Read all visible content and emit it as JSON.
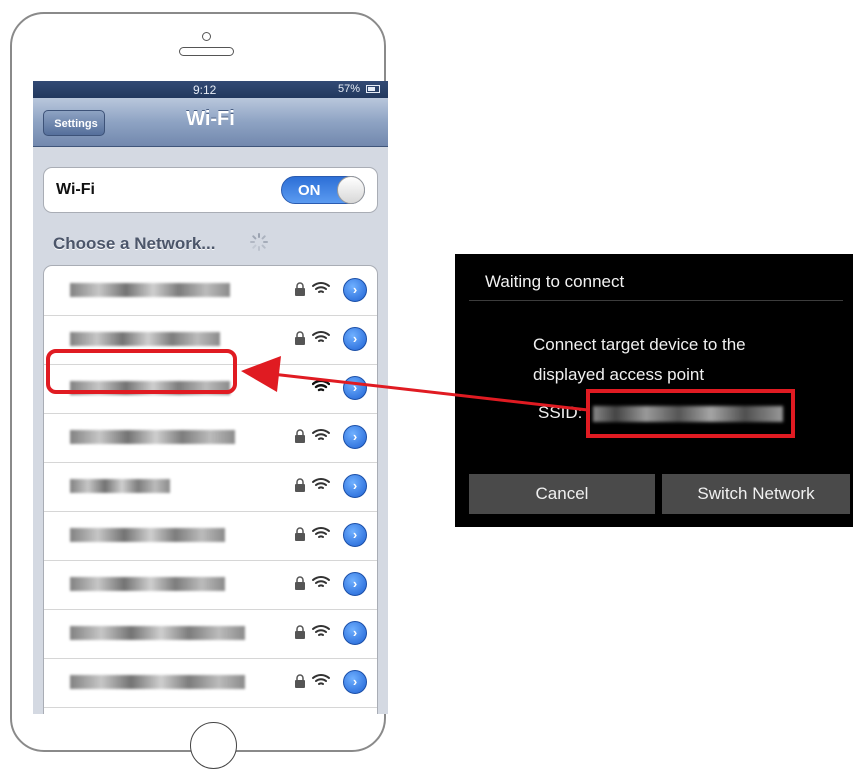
{
  "phone": {
    "status_bar": {
      "time": "9:12",
      "battery": "57%"
    },
    "nav": {
      "back_label": "Settings",
      "title": "Wi-Fi"
    },
    "wifi_toggle": {
      "label": "Wi-Fi",
      "state": "ON"
    },
    "section_header": "Choose a Network...",
    "networks": [
      {
        "name": "",
        "locked": true,
        "selected": false
      },
      {
        "name": "",
        "locked": true,
        "selected": false
      },
      {
        "name": "",
        "locked": false,
        "selected": true
      },
      {
        "name": "",
        "locked": true,
        "selected": false
      },
      {
        "name": "",
        "locked": true,
        "selected": false
      },
      {
        "name": "",
        "locked": true,
        "selected": false
      },
      {
        "name": "",
        "locked": true,
        "selected": false
      },
      {
        "name": "",
        "locked": true,
        "selected": false
      },
      {
        "name": "",
        "locked": true,
        "selected": false
      }
    ]
  },
  "camera_dialog": {
    "title": "Waiting to connect",
    "message_line1": "Connect target device to the",
    "message_line2": "displayed access point",
    "ssid_label": "SSID:",
    "cancel_label": "Cancel",
    "switch_label": "Switch Network"
  },
  "colors": {
    "highlight": "#e01b22",
    "accent_blue": "#2d6fd6"
  }
}
